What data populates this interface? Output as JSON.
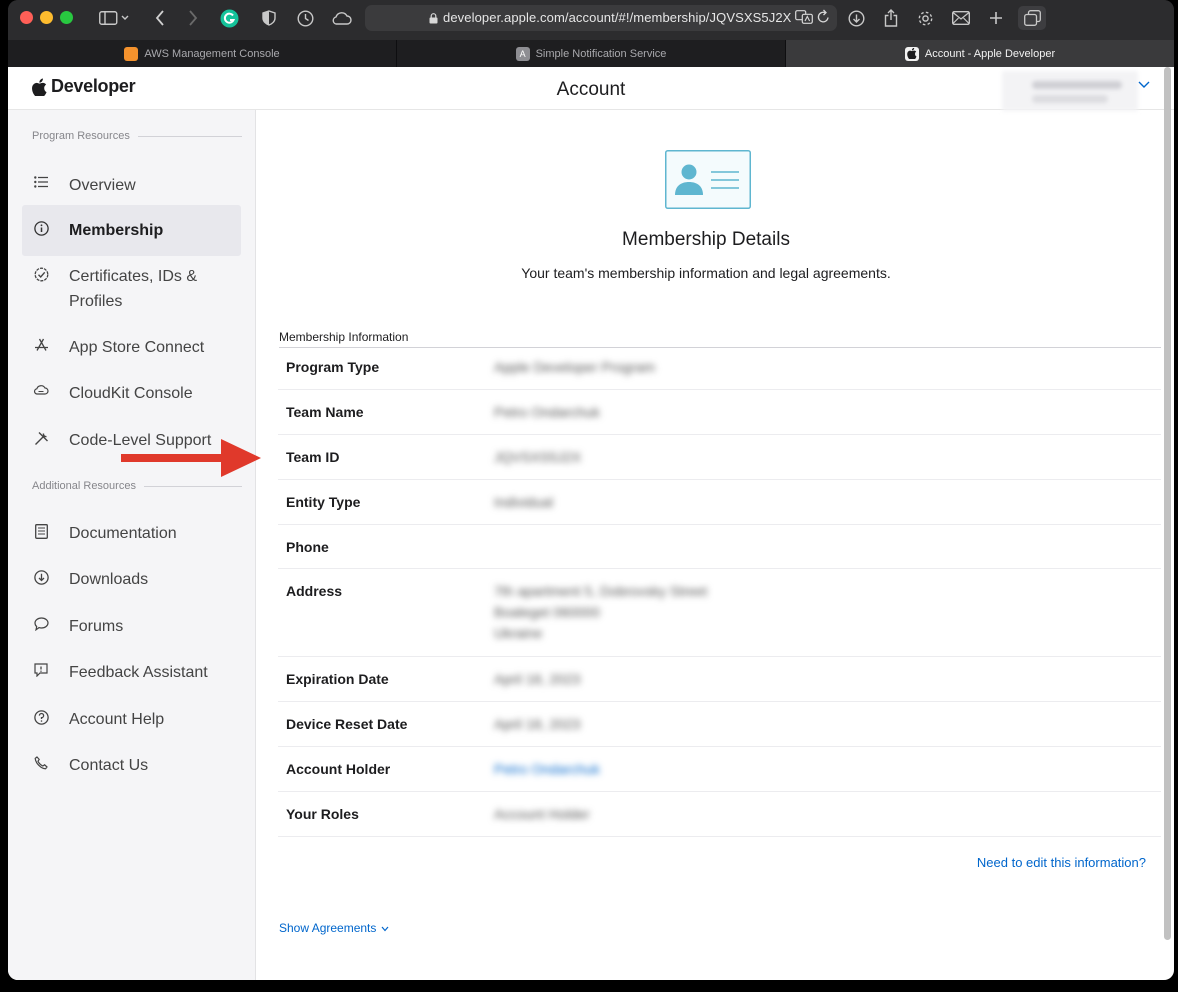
{
  "browser": {
    "url": "developer.apple.com/account/#!/membership/JQVSXS5J2X",
    "tabs": [
      {
        "label": "AWS Management Console"
      },
      {
        "label": "Simple Notification Service"
      },
      {
        "label": "Account - Apple Developer"
      }
    ]
  },
  "header": {
    "logo_text": "Developer",
    "page_title": "Account"
  },
  "sidebar": {
    "program_resources": "Program Resources",
    "additional_resources": "Additional Resources",
    "items": [
      {
        "label": "Overview"
      },
      {
        "label": "Membership"
      },
      {
        "label": "Certificates, IDs & Profiles"
      },
      {
        "label": "App Store Connect"
      },
      {
        "label": "CloudKit Console"
      },
      {
        "label": "Code-Level Support"
      },
      {
        "label": "Documentation"
      },
      {
        "label": "Downloads"
      },
      {
        "label": "Forums"
      },
      {
        "label": "Feedback Assistant"
      },
      {
        "label": "Account Help"
      },
      {
        "label": "Contact Us"
      }
    ]
  },
  "main": {
    "title": "Membership Details",
    "subtitle": "Your team's membership information and legal agreements.",
    "section_title": "Membership Information",
    "rows": [
      {
        "label": "Program Type",
        "value": "Apple Developer Program"
      },
      {
        "label": "Team Name",
        "value": "Petro Ondarchuk"
      },
      {
        "label": "Team ID",
        "value": "JQVSXS5J2X"
      },
      {
        "label": "Entity Type",
        "value": "Individual"
      },
      {
        "label": "Phone",
        "value": ""
      },
      {
        "label": "Address",
        "value_lines": [
          "7th apartment 5, Dobrovsky Street",
          "Boaleget 060000",
          "Ukraine"
        ]
      },
      {
        "label": "Expiration Date",
        "value": "April 18, 2023"
      },
      {
        "label": "Device Reset Date",
        "value": "April 18, 2023"
      },
      {
        "label": "Account Holder",
        "value": "Petro Ondarchuk"
      },
      {
        "label": "Your Roles",
        "value": "Account Holder"
      }
    ],
    "edit_link": "Need to edit this information?",
    "agreements_link": "Show Agreements"
  },
  "colors": {
    "link": "#0066cc",
    "annotation_arrow": "#e0392b",
    "sidebar_bg": "#f5f5f7"
  }
}
